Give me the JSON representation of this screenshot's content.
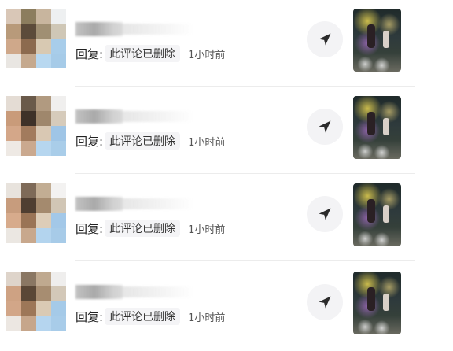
{
  "notifications": [
    {
      "reply_prefix": "回复:",
      "reply_text": "此评论已删除",
      "time": "1小时前"
    },
    {
      "reply_prefix": "回复:",
      "reply_text": "此评论已删除",
      "time": "1小时前"
    },
    {
      "reply_prefix": "回复:",
      "reply_text": "此评论已删除",
      "time": "1小时前"
    },
    {
      "reply_prefix": "回复:",
      "reply_text": "此评论已删除",
      "time": "1小时前"
    }
  ],
  "icons": {
    "send": "send-icon",
    "avatar": "avatar",
    "thumbnail": "video-thumbnail"
  },
  "colors": {
    "send_button_bg": "#f3f3f5",
    "reply_bubble_bg": "#f4f4f6",
    "text": "#222222"
  }
}
